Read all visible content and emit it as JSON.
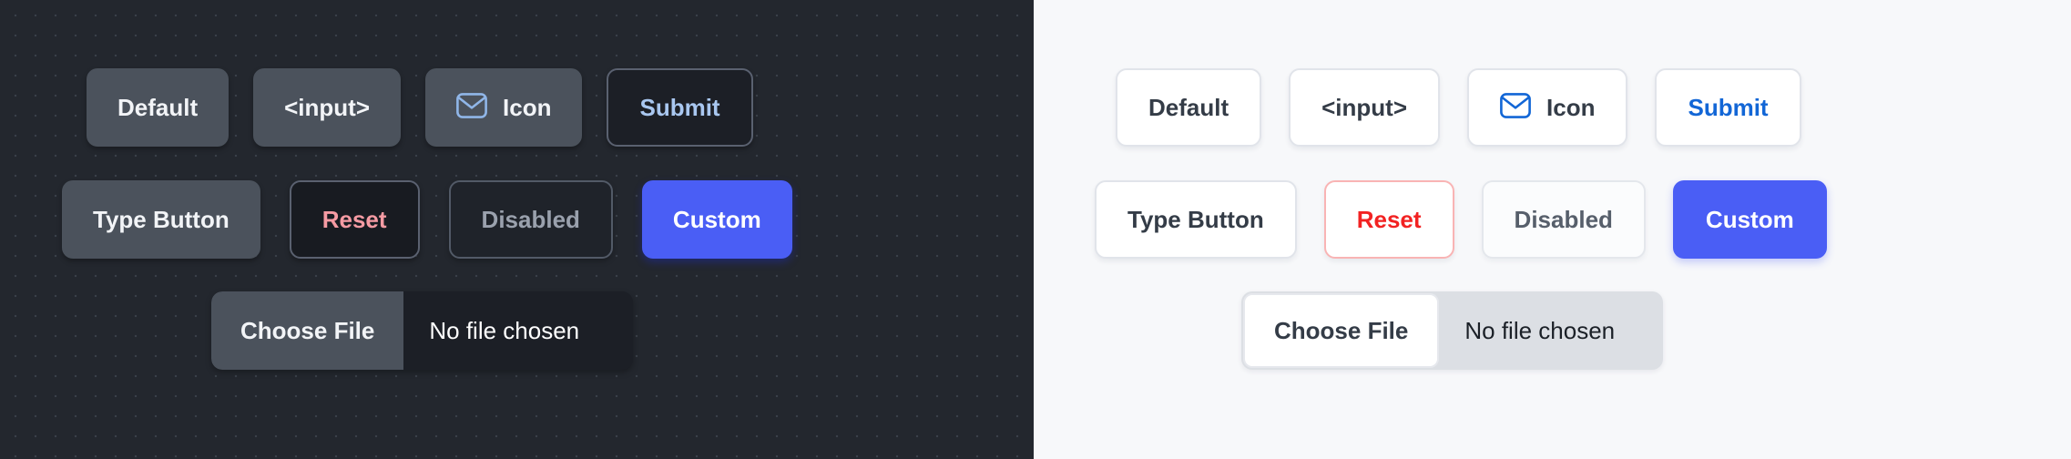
{
  "panels": {
    "dark": {
      "theme_name": "dark",
      "background_color": "#23272e",
      "row1": [
        {
          "label": "Default",
          "variant": "solid"
        },
        {
          "label": "<input>",
          "variant": "solid"
        },
        {
          "label": "Icon",
          "variant": "solid",
          "icon": "envelope-icon",
          "icon_color": "#90b6e8"
        },
        {
          "label": "Submit",
          "variant": "outline",
          "text_color": "#a9c7f0"
        }
      ],
      "row2": [
        {
          "label": "Type Button",
          "variant": "solid"
        },
        {
          "label": "Reset",
          "variant": "outline-danger",
          "text_color": "#f59ba3"
        },
        {
          "label": "Disabled",
          "variant": "disabled",
          "text_color": "#9aa1ad"
        },
        {
          "label": "Custom",
          "variant": "custom",
          "background_color": "#4a5ef5"
        }
      ],
      "file_input": {
        "button_label": "Choose File",
        "status_text": "No file chosen"
      }
    },
    "light": {
      "theme_name": "light",
      "background_color": "#f7f8fa",
      "row1": [
        {
          "label": "Default",
          "variant": "solid"
        },
        {
          "label": "<input>",
          "variant": "solid"
        },
        {
          "label": "Icon",
          "variant": "solid",
          "icon": "envelope-icon",
          "icon_color": "#1266d6"
        },
        {
          "label": "Submit",
          "variant": "link",
          "text_color": "#1266d6"
        }
      ],
      "row2": [
        {
          "label": "Type Button",
          "variant": "solid"
        },
        {
          "label": "Reset",
          "variant": "danger",
          "text_color": "#f22222",
          "border_color": "#f9b4b4"
        },
        {
          "label": "Disabled",
          "variant": "disabled",
          "text_color": "#575f6b"
        },
        {
          "label": "Custom",
          "variant": "custom",
          "background_color": "#4a5ef5"
        }
      ],
      "file_input": {
        "button_label": "Choose File",
        "status_text": "No file chosen"
      }
    }
  }
}
